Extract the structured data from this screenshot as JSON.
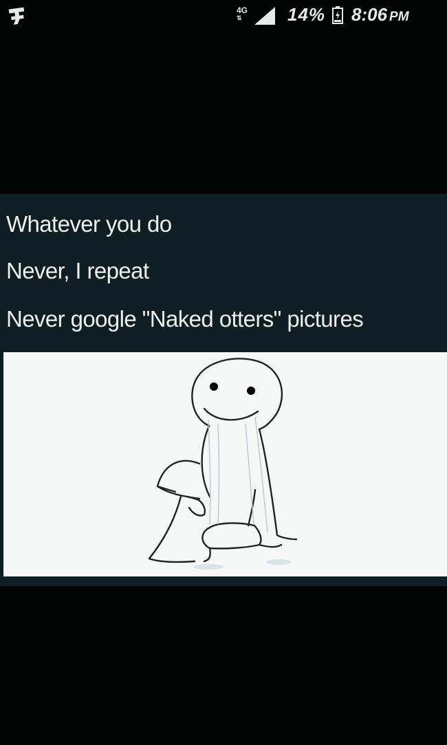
{
  "status_bar": {
    "network_type": "4G",
    "network_arrows": "⇅",
    "battery_percent": "14%",
    "time": "8:06",
    "time_suffix": "PM",
    "icons": [
      "app-notification-icon",
      "signal-icon",
      "battery-icon"
    ]
  },
  "post": {
    "lines": [
      "Whatever you do",
      "Never, I repeat",
      "Never google \"Naked otters\" pictures"
    ],
    "image": {
      "description_icon": "crying-stick-figure-drawing"
    }
  },
  "colors": {
    "background": "#020404",
    "post_background": "#0f1e22",
    "text": "#eef0f0",
    "image_background": "#f6f8f8"
  }
}
